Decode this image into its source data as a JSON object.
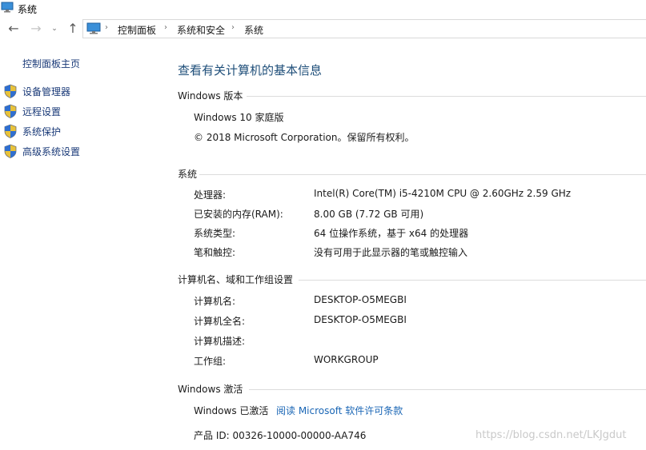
{
  "window": {
    "title": "系统"
  },
  "breadcrumb": [
    "控制面板",
    "系统和安全",
    "系统"
  ],
  "sidebar": {
    "home_label": "控制面板主页",
    "items": [
      {
        "label": "设备管理器",
        "icon": "uac-shield-icon"
      },
      {
        "label": "远程设置",
        "icon": "uac-shield-icon"
      },
      {
        "label": "系统保护",
        "icon": "uac-shield-icon"
      },
      {
        "label": "高级系统设置",
        "icon": "uac-shield-icon"
      }
    ]
  },
  "main": {
    "title": "查看有关计算机的基本信息",
    "edition": {
      "heading": "Windows 版本",
      "name": "Windows 10 家庭版",
      "copyright": "© 2018 Microsoft Corporation。保留所有权利。"
    },
    "system": {
      "heading": "系统",
      "rows": [
        {
          "label": "处理器:",
          "value": "Intel(R) Core(TM) i5-4210M CPU @ 2.60GHz   2.59 GHz"
        },
        {
          "label": "已安装的内存(RAM):",
          "value": "8.00 GB (7.72 GB 可用)"
        },
        {
          "label": "系统类型:",
          "value": "64 位操作系统，基于 x64 的处理器"
        },
        {
          "label": "笔和触控:",
          "value": "没有可用于此显示器的笔或触控输入"
        }
      ]
    },
    "computer": {
      "heading": "计算机名、域和工作组设置",
      "rows": [
        {
          "label": "计算机名:",
          "value": "DESKTOP-O5MEGBI"
        },
        {
          "label": "计算机全名:",
          "value": "DESKTOP-O5MEGBI"
        },
        {
          "label": "计算机描述:",
          "value": ""
        },
        {
          "label": "工作组:",
          "value": "WORKGROUP"
        }
      ]
    },
    "activation": {
      "heading": "Windows 激活",
      "status": "Windows 已激活",
      "license_link": "阅读 Microsoft 软件许可条款",
      "product_id": "产品 ID: 00326-10000-00000-AA746"
    }
  },
  "watermark": "https://blog.csdn.net/LKJgdut",
  "colors": {
    "link": "#1a66b5",
    "title": "#1e4e79",
    "sidebar_link": "#1a3a78"
  }
}
